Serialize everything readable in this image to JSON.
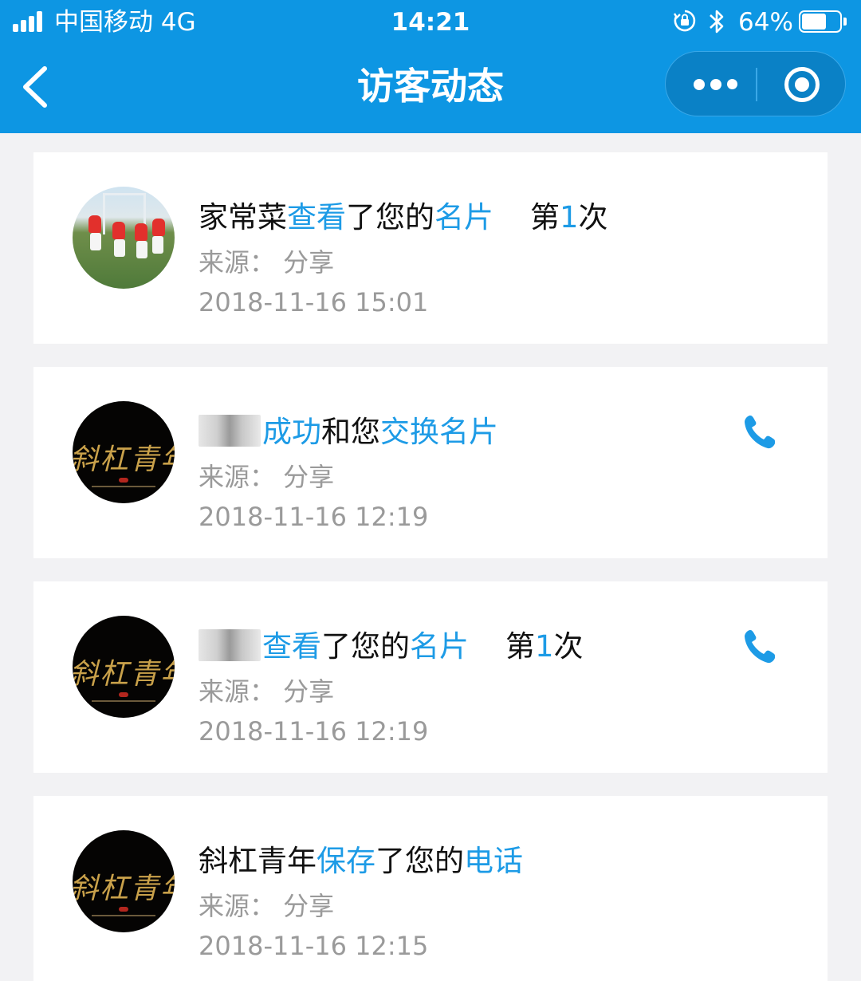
{
  "status_bar": {
    "carrier": "中国移动 4G",
    "time": "14:21",
    "battery": "64%",
    "battery_level": 0.64
  },
  "nav": {
    "title": "访客动态"
  },
  "colors": {
    "accent": "#0d96e3",
    "highlight": "#1d9be6"
  },
  "visits": [
    {
      "name": "家常菜",
      "action": "查看",
      "middle": "了您的",
      "object": "名片",
      "count_prefix": "第",
      "count": "1",
      "count_suffix": "次",
      "source": "来源：  分享",
      "time": "2018-11-16 15:01"
    },
    {
      "action": "成功",
      "middle": "和您",
      "object": "交换名片",
      "source": "来源：  分享",
      "time": "2018-11-16 12:19"
    },
    {
      "action": "查看",
      "middle": "了您的",
      "object": "名片",
      "count_prefix": "第",
      "count": "1",
      "count_suffix": "次",
      "source": "来源：  分享",
      "time": "2018-11-16 12:19"
    },
    {
      "name": "斜杠青年",
      "action": "保存",
      "middle": "了您的",
      "object": "电话",
      "source": "来源：  分享",
      "time": "2018-11-16 12:15"
    }
  ]
}
